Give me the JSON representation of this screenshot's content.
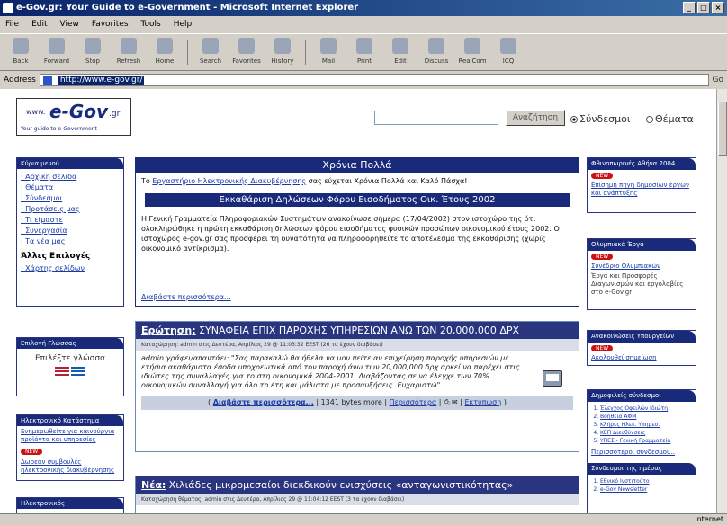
{
  "window": {
    "title": "e-Gov.gr: Your Guide to e-Government - Microsoft Internet Explorer",
    "min": "_",
    "max": "□",
    "close": "×"
  },
  "menu": [
    "File",
    "Edit",
    "View",
    "Favorites",
    "Tools",
    "Help"
  ],
  "toolbar": [
    "Back",
    "Forward",
    "Stop",
    "Refresh",
    "Home",
    "Search",
    "Favorites",
    "History",
    "Mail",
    "Print",
    "Edit",
    "Discuss",
    "RealCom",
    "ICQ"
  ],
  "address": {
    "label": "Address",
    "url": "http://www.e-gov.gr/",
    "go": "Go"
  },
  "logo": {
    "www": "www.",
    "brand": "e-Gov",
    "tld": ".gr",
    "tagline": "Your guide to e-Government"
  },
  "search": {
    "button": "Αναζήτηση",
    "opt1": "Σύνδεσμοι",
    "opt2": "Θέματα"
  },
  "left": {
    "nav": {
      "header": "Κύρια μενού",
      "items": [
        "Αρχική σελίδα",
        "Θέματα",
        "Σύνδεσμοι",
        "Προτάσεις μας",
        "Τι είμαστε",
        "Συνεργασία",
        "Τα νέα μας"
      ],
      "sub_title": "Άλλες Επιλογές",
      "sub_items": [
        "Χάρτης σελίδων"
      ]
    },
    "lang": {
      "header": "Επιλογή Γλώσσας",
      "text": "Επιλέξτε γλώσσα"
    },
    "news": {
      "header": "Ηλεκτρονικό Κατάστημα",
      "link1": "Ενημερωθείτε για καινούργια προϊόντα και υπηρεσίες",
      "badge": "NEW",
      "link2": "Δωρεάν συμβουλές ηλεκτρονικής διακυβέρνησης"
    },
    "other": {
      "header": "Ηλεκτρονικός"
    }
  },
  "center": {
    "welcome": {
      "header": "Χρόνια Πολλά",
      "pre": "Το ",
      "link": "Εργαστήριο Ηλεκτρονικής Διακυβέρνησης",
      "post": " σας εύχεται Χρόνια Πολλά και Καλό Πάσχα!"
    },
    "feature": {
      "header": "Εκκαθάριση Δηλώσεων Φόρου Εισοδήματος Οικ. Έτους 2002",
      "text": "Η Γενική Γραμματεία Πληροφοριακών Συστημάτων ανακοίνωσε σήμερα (17/04/2002) στον ιστοχώρο της ότι ολοκληρώθηκε η πρώτη εκκαθάριση δηλώσεων φόρου εισοδήματος φυσικών προσώπων οικονομικού έτους 2002. Ο ιστοχώρος e-gov.gr σας προσφέρει τη δυνατότητα να πληροφορηθείτε το αποτέλεσμα της εκκαθάρισης (χωρίς οικονομικό αντίκρισμα).",
      "more": "Διαβάστε περισσότερα..."
    },
    "article1": {
      "label": "Ερώτηση:",
      "title": "ΣΥΝΑΦΕΙΑ ΕΠΙΧ ΠΑΡΟΧΗΣ ΥΠΗΡΕΣΙΩΝ ΑΝΩ ΤΩΝ 20,000,000 ΔΡΧ",
      "meta": "Καταχώρηση: admin στις Δευτέρα, Απρίλιος 29 @ 11:03:32 EEST (26 τα έχουν διαβάσει)",
      "body": "admin γράφει/απαντάει: \"Σας παρακαλώ θα ήθελα να μου πείτε αν επιχείρηση παροχής υπηρεσιών με ετήσια ακαθάριστα έσοδα υποχρεωτικά από τον παροχή άνω των 20,000,000 δρχ αρκεί να παρέχει στις ιδιώτες της συναλλαγές για το στη οικονομικά 2004-2001. Διαβάζοντας σε να έλεγχε των 70% οικονομικών συναλλαγή για όλο το έτη και μάλιστα με προσαυξήσεις. Ευχαριστώ\"",
      "read": "Διαβάστε περισσότερα...",
      "bytes": "1341 bytes more",
      "comments": "Περισσότερα",
      "print_label": "Εκτύπωση"
    },
    "article2": {
      "label": "Νέα:",
      "title": "Χιλιάδες μικρομεσαίοι διεκδικούν ενισχύσεις «ανταγωνιστικότητας»",
      "meta": "Καταχώρηση θέματος: admin στις Δευτέρα, Απρίλιος 29 @ 11:04:12 EEST (3 τα έχουν διαβάσει)"
    }
  },
  "right": {
    "box1": {
      "header": "Φθινοπωρινές Αθήνα 2004",
      "badge": "NEW",
      "link": "Επίσημη πηγή δημοσίων έργων και ανάπτυξης"
    },
    "box2": {
      "header": "Ολυμπιακά Έργα",
      "badge": "NEW",
      "link": "Συνέδριο Ολυμπιακών",
      "text": "Έργα και Προσφορές Διαγωνισμών και εργολαβίες στο e-Gov.gr"
    },
    "box3": {
      "header": "Ανακοινώσεις Υπουργείων",
      "badge": "NEW",
      "link": "Ακολουθεί σημείωση"
    },
    "box4": {
      "header": "Δημοφιλείς σύνδεσμοι",
      "items": [
        "Έλεγχος Οφειλών Ιδιώτη",
        "Βοήθεια ΑΦΜ",
        "Κλήρες Ηλεκ. Υπηρεσ.",
        "ΚΕΠ Διευθύνσεις",
        "ΥΠΕΣ - Γενική Γραμματεία"
      ],
      "more": "Περισσότεροι σύνδεσμοι...",
      "footer_header": "Σύνδεσμοι της ημέρας",
      "footer_items": [
        "Εθνικό Ινστιτούτο",
        "e-Gov Newsletter"
      ]
    }
  },
  "status": {
    "left": "",
    "right": "Internet"
  }
}
